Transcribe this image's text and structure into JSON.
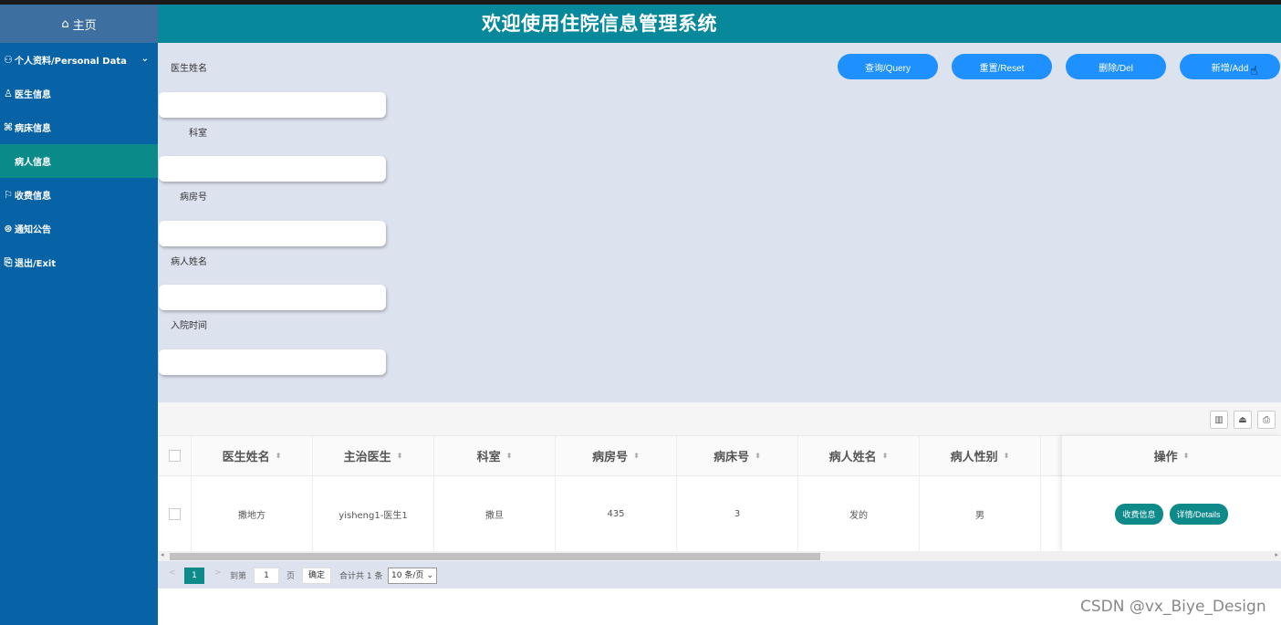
{
  "app": {
    "title": "欢迎使用住院信息管理系统"
  },
  "sidebar": {
    "home": "主页",
    "items": [
      {
        "label": "个人资料/Personal Data",
        "icon": "user-list-icon"
      },
      {
        "label": "医生信息",
        "icon": "user-icon"
      },
      {
        "label": "病床信息",
        "icon": "bed-icon"
      },
      {
        "label": "病人信息",
        "icon": "",
        "active": true
      },
      {
        "label": "收费信息",
        "icon": "ticket-icon"
      },
      {
        "label": "通知公告",
        "icon": "notice-icon"
      },
      {
        "label": "退出/Exit",
        "icon": "exit-icon"
      }
    ]
  },
  "search": {
    "fields": [
      {
        "label": "医生姓名",
        "value": ""
      },
      {
        "label": "科室",
        "value": ""
      },
      {
        "label": "病房号",
        "value": ""
      },
      {
        "label": "病人姓名",
        "value": ""
      },
      {
        "label": "入院时间",
        "value": ""
      }
    ],
    "buttons": {
      "query": "查询/Query",
      "reset": "重置/Reset",
      "delete": "删除/Del",
      "add": "新增/Add"
    },
    "button_color": "#1e90ff"
  },
  "table": {
    "columns": [
      "医生姓名",
      "主治医生",
      "科室",
      "病房号",
      "病床号",
      "病人姓名",
      "病人性别",
      "操作"
    ],
    "rows": [
      {
        "cells": [
          "撒地方",
          "yisheng1-医生1",
          "撒旦",
          "435",
          "3",
          "发的",
          "男"
        ]
      }
    ],
    "row_actions": {
      "fee": "收费信息",
      "details": "详情/Details"
    },
    "accent": "#0e8a8a"
  },
  "pager": {
    "prev": "<",
    "current": "1",
    "next": ">",
    "goto_label": "到第",
    "goto_value": "1",
    "page_unit": "页",
    "confirm": "确定",
    "total": "合计共 1 条",
    "page_size": "10 条/页"
  },
  "watermark": "CSDN @vx_Biye_Design"
}
